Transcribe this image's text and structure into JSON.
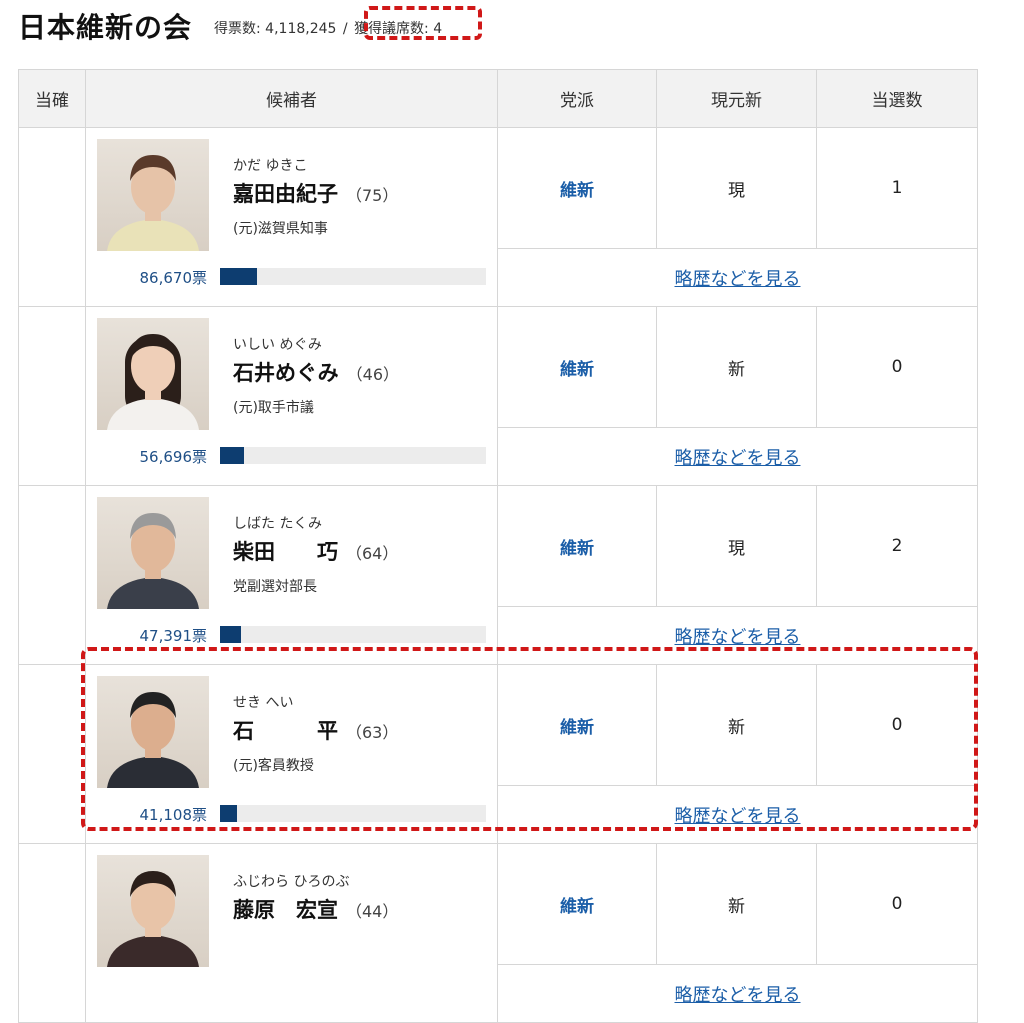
{
  "header": {
    "party_name": "日本維新の会",
    "votes_text": "得票数: 4,118,245",
    "separator": "/",
    "seats_text": "獲得議席数: 4"
  },
  "table": {
    "columns": [
      "当確",
      "候補者",
      "党派",
      "現元新",
      "当選数"
    ],
    "link_label": "略歴などを見る",
    "candidates": [
      {
        "kana": "かだ ゆきこ",
        "name": "嘉田由紀子",
        "age": "（75）",
        "title": "(元)滋賀県知事",
        "votes": "86,670票",
        "vote_share": 0.14,
        "party": "維新",
        "status": "現",
        "wins": "1"
      },
      {
        "kana": "いしい めぐみ",
        "name": "石井めぐみ",
        "age": "（46）",
        "title": "(元)取手市議",
        "votes": "56,696票",
        "vote_share": 0.09,
        "party": "維新",
        "status": "新",
        "wins": "0"
      },
      {
        "kana": "しばた たくみ",
        "name": "柴田　　巧",
        "age": "（64）",
        "title": "党副選対部長",
        "votes": "47,391票",
        "vote_share": 0.08,
        "party": "維新",
        "status": "現",
        "wins": "2"
      },
      {
        "kana": "せき へい",
        "name": "石　　　平",
        "age": "（63）",
        "title": "(元)客員教授",
        "votes": "41,108票",
        "vote_share": 0.065,
        "party": "維新",
        "status": "新",
        "wins": "0"
      },
      {
        "kana": "ふじわら ひろのぶ",
        "name": "藤原　宏宣",
        "age": "（44）",
        "title": "",
        "votes": "",
        "vote_share": 0,
        "party": "維新",
        "status": "新",
        "wins": "0"
      }
    ]
  },
  "colors": {
    "accent_link": "#1b5ea8",
    "bar": "#0d3d70",
    "highlight": "#d01818"
  }
}
